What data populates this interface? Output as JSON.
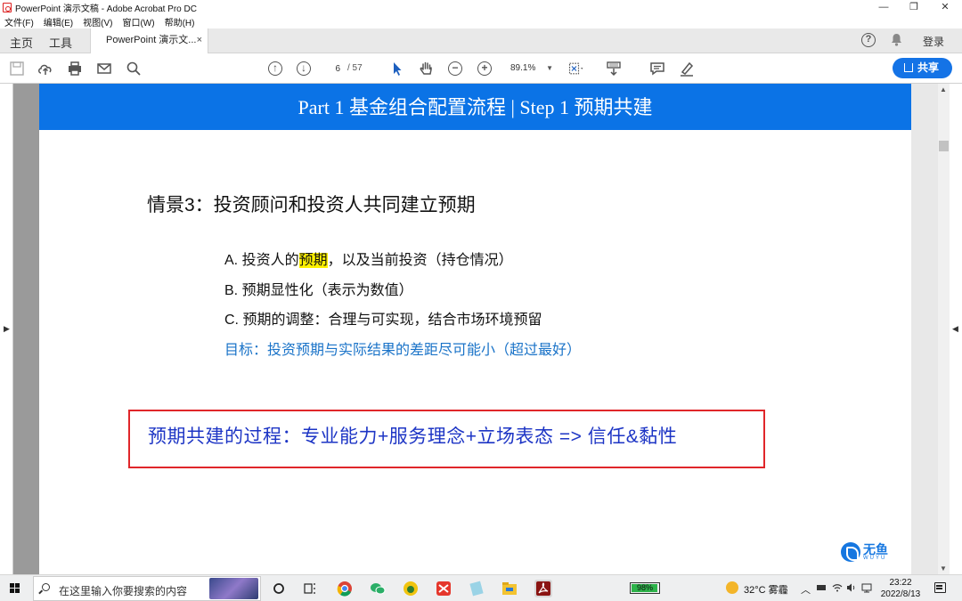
{
  "window": {
    "title": "PowerPoint 演示文稿 - Adobe Acrobat Pro DC",
    "minimize": "—",
    "restore": "❐",
    "close": "✕"
  },
  "menu": [
    "文件(F)",
    "编辑(E)",
    "视图(V)",
    "窗口(W)",
    "帮助(H)"
  ],
  "tabs": {
    "home": "主页",
    "tools": "工具",
    "document": "PowerPoint 演示文...",
    "close": "×"
  },
  "account": {
    "help": "?",
    "login": "登录"
  },
  "toolbar": {
    "page_current": "6",
    "page_total": "/ 57",
    "zoom": "89.1%",
    "share": "共享"
  },
  "slide": {
    "header": "Part 1 基金组合配置流程 | Step 1 预期共建",
    "scenario": "情景3：投资顾问和投资人共同建立预期",
    "items": {
      "a_prefix": "A.  投资人的",
      "a_highlight": "预期",
      "a_suffix": "，以及当前投资（持仓情况）",
      "b": "B.  预期显性化（表示为数值）",
      "c": "C.  预期的调整：合理与可实现，结合市场环境预留"
    },
    "goal": "目标：投资预期与实际结果的差距尽可能小（超过最好）",
    "callout": "预期共建的过程：专业能力+服务理念+立场表态  =>  信任&黏性",
    "logo_cn": "无鱼",
    "logo_en": "WUYU"
  },
  "taskbar": {
    "search_placeholder": "在这里输入你要搜索的内容",
    "battery": "98%",
    "battery_level": 0.98,
    "temperature": "32°C",
    "weather": "雾霾",
    "time": "23:22",
    "date": "2022/8/13"
  },
  "colors": {
    "accent": "#1473e6",
    "header": "#0b73e6",
    "callout_border": "#e0262a",
    "callout_text": "#1d35c5",
    "goal_text": "#1a73c8",
    "highlight": "#fff200"
  }
}
